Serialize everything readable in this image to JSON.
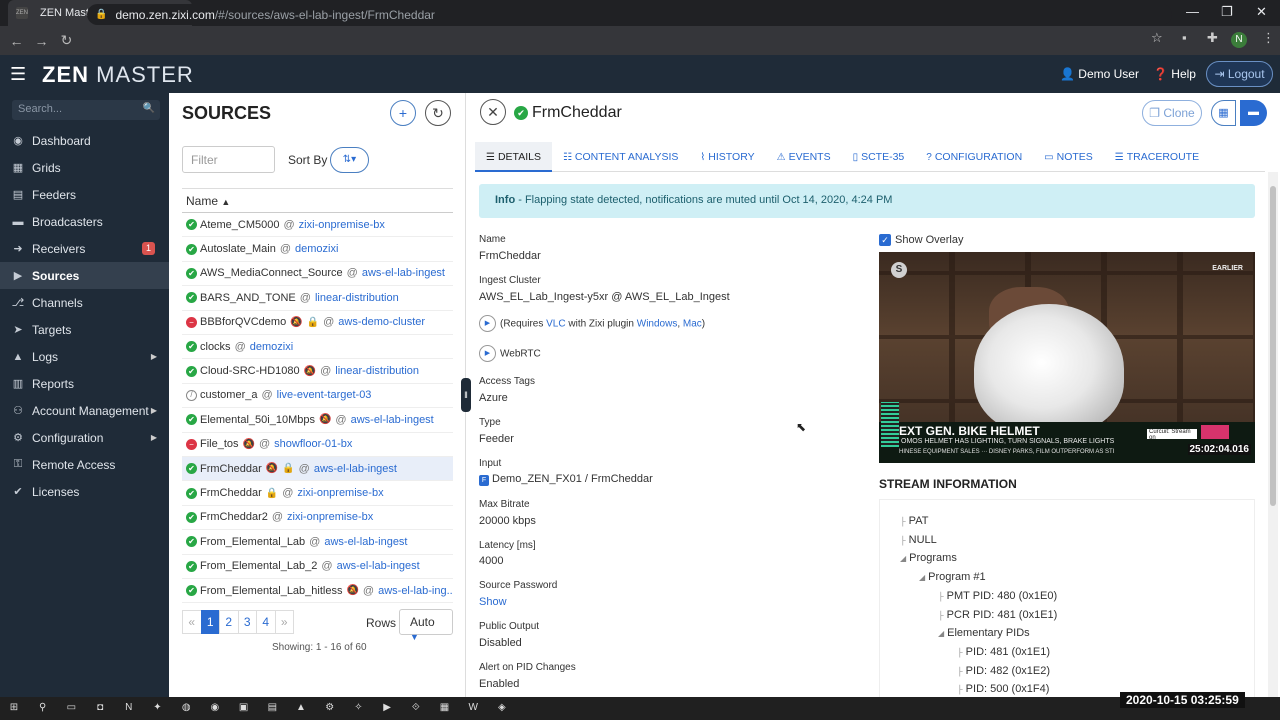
{
  "browser": {
    "tab_title": "ZEN Master",
    "tab_favicon": "ZEN",
    "url_host": "demo.zen.zixi.com",
    "url_path": "/#/sources/aws-el-lab-ingest/FrmCheddar",
    "avatar_letter": "N"
  },
  "header": {
    "logo_zen": "ZEN",
    "logo_master": "MASTER",
    "user": "Demo User",
    "help": "Help",
    "logout": "Logout"
  },
  "sidebar": {
    "search_placeholder": "Search...",
    "items": [
      {
        "label": "Dashboard",
        "icon": "dashboard-icon",
        "glyph": "◉"
      },
      {
        "label": "Grids",
        "icon": "grid-icon",
        "glyph": "▦"
      },
      {
        "label": "Feeders",
        "icon": "feeder-icon",
        "glyph": "▤"
      },
      {
        "label": "Broadcasters",
        "icon": "broadcaster-icon",
        "glyph": "▬"
      },
      {
        "label": "Receivers",
        "icon": "receiver-icon",
        "glyph": "➜",
        "badge": "1"
      },
      {
        "label": "Sources",
        "icon": "sources-icon",
        "glyph": "▶"
      },
      {
        "label": "Channels",
        "icon": "channels-icon",
        "glyph": "⎇"
      },
      {
        "label": "Targets",
        "icon": "targets-icon",
        "glyph": "➤"
      },
      {
        "label": "Logs",
        "icon": "logs-icon",
        "glyph": "▲"
      },
      {
        "label": "Reports",
        "icon": "reports-icon",
        "glyph": "▥"
      },
      {
        "label": "Account Management",
        "icon": "account-icon",
        "glyph": "⚇"
      },
      {
        "label": "Configuration",
        "icon": "configuration-icon",
        "glyph": "⚙"
      },
      {
        "label": "Remote Access",
        "icon": "remote-access-icon",
        "glyph": "⚿"
      },
      {
        "label": "Licenses",
        "icon": "licenses-icon",
        "glyph": "✔"
      }
    ]
  },
  "sources": {
    "title": "SOURCES",
    "filter_placeholder": "Filter",
    "sort_by": "Sort By",
    "column_name": "Name",
    "rows": [
      {
        "status": "ok",
        "name": "Ateme_CM5000",
        "cluster": "zixi-onpremise-bx",
        "muted": false,
        "locked": false
      },
      {
        "status": "ok",
        "name": "Autoslate_Main",
        "cluster": "demozixi",
        "muted": false,
        "locked": false
      },
      {
        "status": "ok",
        "name": "AWS_MediaConnect_Source",
        "cluster": "aws-el-lab-ingest",
        "muted": false,
        "locked": false
      },
      {
        "status": "ok",
        "name": "BARS_AND_TONE",
        "cluster": "linear-distribution",
        "muted": false,
        "locked": false
      },
      {
        "status": "err",
        "name": "BBBforQVCdemo",
        "cluster": "aws-demo-cluster",
        "muted": true,
        "locked": true
      },
      {
        "status": "ok",
        "name": "clocks",
        "cluster": "demozixi",
        "muted": false,
        "locked": false
      },
      {
        "status": "ok",
        "name": "Cloud-SRC-HD1080",
        "cluster": "linear-distribution",
        "muted": true,
        "locked": false
      },
      {
        "status": "off",
        "name": "customer_a",
        "cluster": "live-event-target-03",
        "muted": false,
        "locked": false
      },
      {
        "status": "ok",
        "name": "Elemental_50i_10Mbps",
        "cluster": "aws-el-lab-ingest",
        "muted": true,
        "locked": false
      },
      {
        "status": "err",
        "name": "File_tos",
        "cluster": "showfloor-01-bx",
        "muted": true,
        "locked": false
      },
      {
        "status": "ok",
        "name": "FrmCheddar",
        "cluster": "aws-el-lab-ingest",
        "muted": true,
        "locked": true,
        "selected": true
      },
      {
        "status": "ok",
        "name": "FrmCheddar",
        "cluster": "zixi-onpremise-bx",
        "muted": false,
        "locked": true
      },
      {
        "status": "ok",
        "name": "FrmCheddar2",
        "cluster": "zixi-onpremise-bx",
        "muted": false,
        "locked": false
      },
      {
        "status": "ok",
        "name": "From_Elemental_Lab",
        "cluster": "aws-el-lab-ingest",
        "muted": false,
        "locked": false
      },
      {
        "status": "ok",
        "name": "From_Elemental_Lab_2",
        "cluster": "aws-el-lab-ingest",
        "muted": false,
        "locked": false
      },
      {
        "status": "ok",
        "name": "From_Elemental_Lab_hitless",
        "cluster": "aws-el-lab-ing...",
        "muted": true,
        "locked": false
      }
    ],
    "pages": [
      "1",
      "2",
      "3",
      "4"
    ],
    "prev": "«",
    "next": "»",
    "rows_label": "Rows",
    "rows_value": "Auto",
    "showing": "Showing: 1 - 16 of 60"
  },
  "detail": {
    "title": "FrmCheddar",
    "clone": "Clone",
    "tabs": [
      {
        "label": "DETAILS",
        "glyph": "☰"
      },
      {
        "label": "CONTENT ANALYSIS",
        "glyph": "☷"
      },
      {
        "label": "HISTORY",
        "glyph": "⌇"
      },
      {
        "label": "EVENTS",
        "glyph": "⚠"
      },
      {
        "label": "SCTE-35",
        "glyph": "▯"
      },
      {
        "label": "CONFIGURATION",
        "glyph": "?"
      },
      {
        "label": "NOTES",
        "glyph": "▭"
      },
      {
        "label": "TRACEROUTE",
        "glyph": "☰"
      }
    ],
    "info_label": "Info",
    "info_text": "- Flapping state detected, notifications are muted until Oct 14, 2020, 4:24 PM",
    "fields": {
      "name_label": "Name",
      "name_value": "FrmCheddar",
      "ingest_label": "Ingest Cluster",
      "ingest_value": "AWS_EL_Lab_Ingest-y5xr @ AWS_EL_Lab_Ingest",
      "req_prefix": "(Requires",
      "req_vlc": "VLC",
      "req_mid": "with Zixi plugin",
      "req_win": "Windows",
      "req_comma": ",",
      "req_mac": "Mac",
      "req_close": ")",
      "webrtc": "WebRTC",
      "tags_label": "Access Tags",
      "tags_value": "Azure",
      "type_label": "Type",
      "type_value": "Feeder",
      "input_label": "Input",
      "input_value": "Demo_ZEN_FX01 / FrmCheddar",
      "bitrate_label": "Max Bitrate",
      "bitrate_value": "20000 kbps",
      "latency_label": "Latency [ms]",
      "latency_value": "4000",
      "pwd_label": "Source Password",
      "pwd_value": "Show",
      "public_label": "Public Output",
      "public_value": "Disabled",
      "pid_label": "Alert on PID Changes",
      "pid_value": "Enabled"
    },
    "overlay_label": "Show Overlay",
    "video": {
      "channel_logo": "S",
      "tag": "EARLIER",
      "headline": "EXT GEN. BIKE HELMET",
      "sub": "OMOS HELMET HAS LIGHTING, TURN SIGNALS, BRAKE LIGHTS",
      "ticker": "HINESE EQUIPMENT SALES  ··· DISNEY PARKS, FILM OUTPERFORM AS STI",
      "timecode": "25:02:04.016",
      "promo": "Curcuit: Stream on"
    },
    "stream_title": "STREAM INFORMATION",
    "stream_tree": [
      {
        "label": "PAT"
      },
      {
        "label": "NULL"
      },
      {
        "label": "Programs"
      },
      {
        "label": "Program #1"
      },
      {
        "label": "PMT PID: 480 (0x1E0)"
      },
      {
        "label": "PCR PID: 481 (0x1E1)"
      },
      {
        "label": "Elementary PIDs"
      },
      {
        "label": "PID: 481 (0x1E1)"
      },
      {
        "label": "PID: 482 (0x1E2)"
      },
      {
        "label": "PID: 500 (0x1F4)"
      }
    ]
  },
  "taskbar": {
    "clock": "2020-10-15  03:25:59"
  },
  "colors": {
    "sidebar_bg": "#1f2b38",
    "accent": "#2a6bd1",
    "ok": "#28a745",
    "error": "#dc3545",
    "info_bg": "#cfeff5"
  }
}
